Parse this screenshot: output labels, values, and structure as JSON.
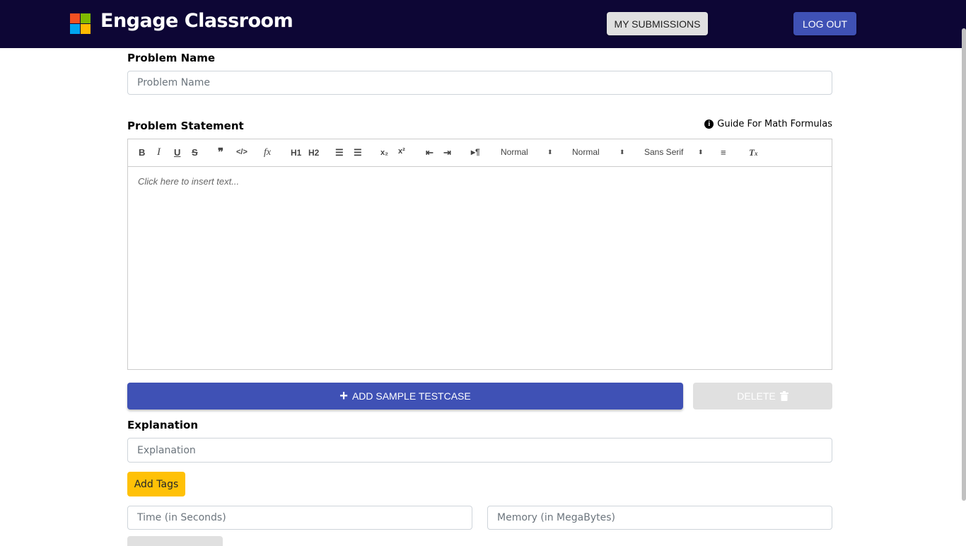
{
  "header": {
    "brand": "Engage Classroom",
    "logo_colors": [
      "#f25022",
      "#7fba00",
      "#00a4ef",
      "#ffb900"
    ],
    "my_submissions_label": "MY SUBMISSIONS",
    "logout_label": "LOG OUT"
  },
  "form": {
    "problem_name_label": "Problem Name",
    "problem_name_placeholder": "Problem Name",
    "problem_statement_label": "Problem Statement",
    "guide_link": "Guide For Math Formulas",
    "editor": {
      "header_select": "Normal",
      "size_select": "Normal",
      "font_select": "Sans Serif",
      "placeholder": "Click here to insert text..."
    },
    "add_testcase_label": "ADD SAMPLE TESTCASE",
    "delete_label": "DELETE",
    "explanation_label": "Explanation",
    "explanation_placeholder": "Explanation",
    "add_tags_label": "Add Tags",
    "time_placeholder": "Time (in Seconds)",
    "memory_placeholder": "Memory (in MegaBytes)"
  },
  "colors": {
    "header_bg": "#0d0635",
    "primary": "#3f51b5",
    "warning": "#ffc107"
  }
}
